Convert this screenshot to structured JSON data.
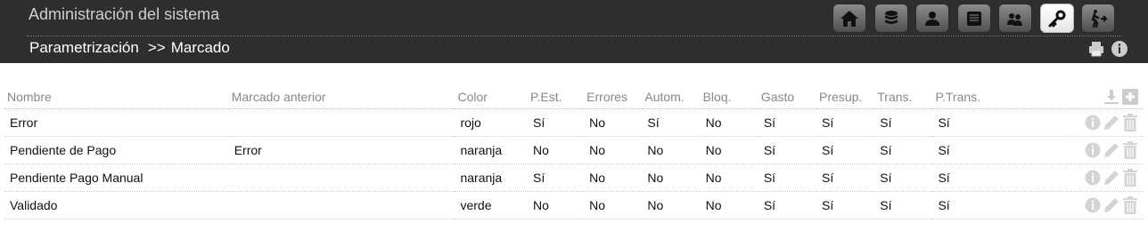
{
  "app": {
    "title": "Administración del sistema"
  },
  "breadcrumb": {
    "section": "Parametrización",
    "separator": ">>",
    "current": "Marcado"
  },
  "nav_icons": [
    "home-icon",
    "database-icon",
    "user-icon",
    "book-icon",
    "users-icon",
    "key-icon",
    "exit-icon"
  ],
  "nav_active": "key-icon",
  "tools": [
    "print-icon",
    "info-icon"
  ],
  "colors": {
    "header": "#2e2e2e",
    "nav_button": "#6a6a6a",
    "muted_icon": "#cfcfcf"
  },
  "table": {
    "columns": [
      "Nombre",
      "Marcado anterior",
      "Color",
      "P.Est.",
      "Errores",
      "Autom.",
      "Bloq.",
      "Gasto",
      "Presup.",
      "Trans.",
      "P.Trans."
    ],
    "header_actions": [
      "download-icon",
      "add-icon"
    ],
    "row_actions": [
      "info-icon",
      "edit-icon",
      "delete-icon"
    ],
    "rows": [
      [
        "Error",
        "",
        "rojo",
        "Sí",
        "No",
        "Sí",
        "No",
        "Sí",
        "Sí",
        "Sí",
        "Sí"
      ],
      [
        "Pendiente de Pago",
        "Error",
        "naranja",
        "No",
        "No",
        "No",
        "No",
        "Sí",
        "Sí",
        "Sí",
        "Sí"
      ],
      [
        "Pendiente Pago Manual",
        "",
        "naranja",
        "Sí",
        "No",
        "No",
        "No",
        "Sí",
        "Sí",
        "Sí",
        "Sí"
      ],
      [
        "Validado",
        "",
        "verde",
        "No",
        "No",
        "No",
        "No",
        "Sí",
        "Sí",
        "Sí",
        "Sí"
      ]
    ]
  }
}
